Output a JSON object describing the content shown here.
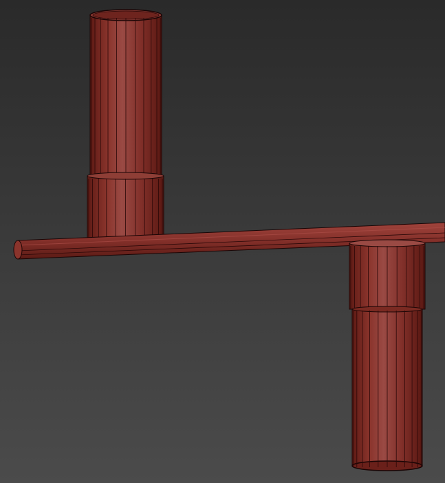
{
  "viewport": {
    "background_top": "#2b2b2b",
    "background_bottom": "#4a4a4a"
  },
  "model": {
    "material_color": "#7a2a22",
    "edge_color": "#1a0505",
    "highlight_color": "#b0504a",
    "objects": [
      {
        "name": "horizontal-rod"
      },
      {
        "name": "upper-cylinder"
      },
      {
        "name": "upper-cylinder-collar"
      },
      {
        "name": "lower-cylinder"
      },
      {
        "name": "lower-cylinder-collar"
      }
    ]
  }
}
